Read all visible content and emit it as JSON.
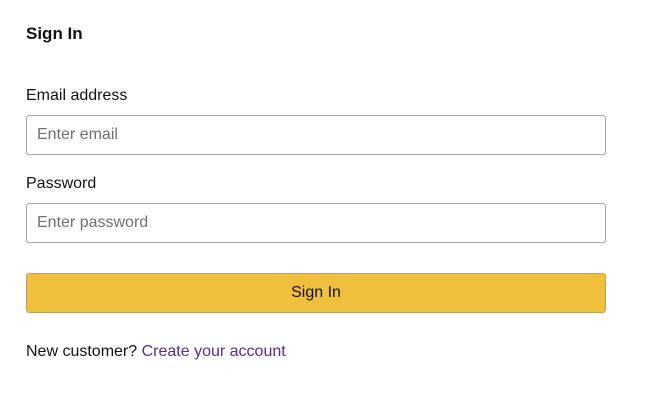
{
  "form": {
    "title": "Sign In",
    "email": {
      "label": "Email address",
      "placeholder": "Enter email",
      "value": ""
    },
    "password": {
      "label": "Password",
      "placeholder": "Enter password",
      "value": ""
    },
    "submit_label": "Sign In",
    "footer": {
      "prompt": "New customer?",
      "link_text": "Create your account"
    }
  },
  "colors": {
    "submit_background": "#f0c03d",
    "link": "#5b2a86",
    "input_border": "#a6a6a6"
  }
}
